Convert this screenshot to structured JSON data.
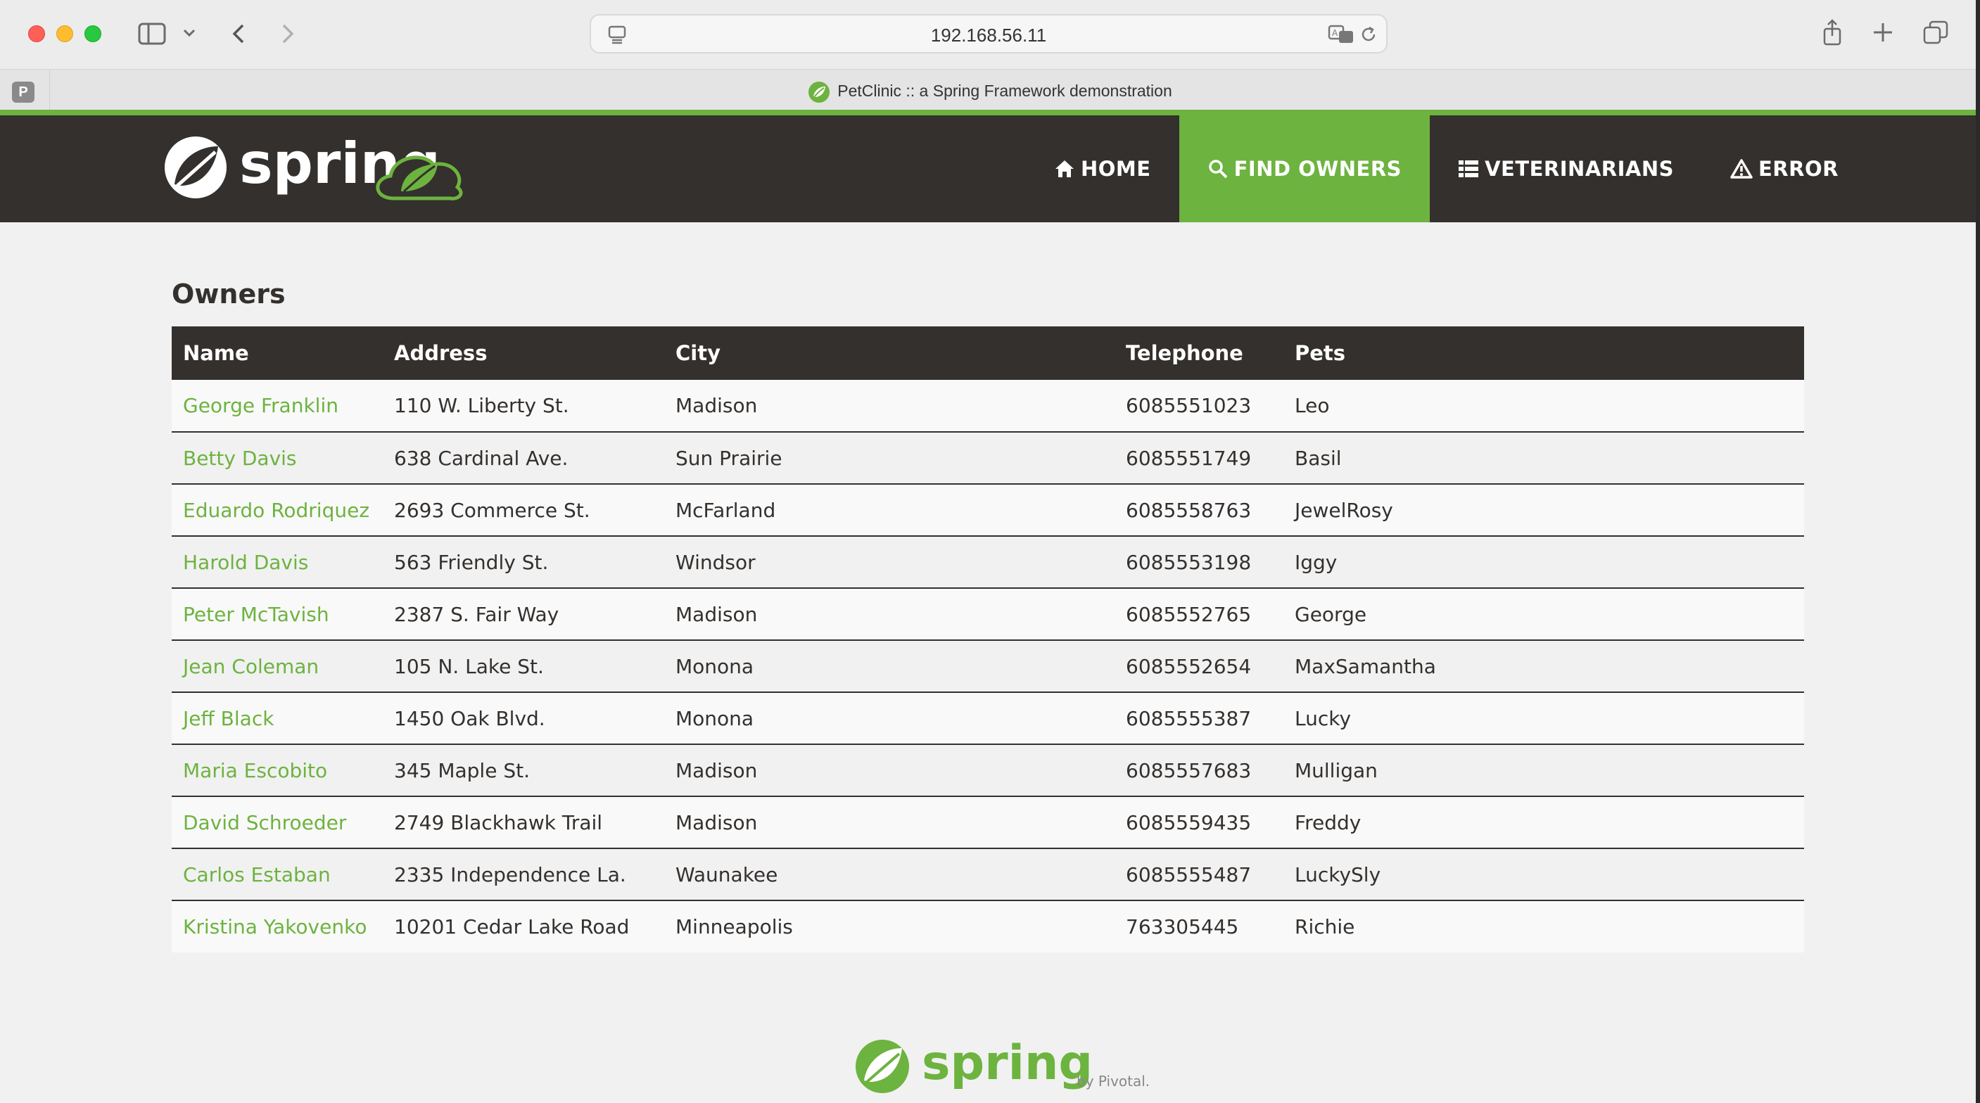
{
  "browser": {
    "address": "192.168.56.11",
    "tab_title": "PetClinic :: a Spring Framework demonstration",
    "tab_pinned_letter": "P"
  },
  "nav": {
    "items": [
      {
        "label": "HOME",
        "icon": "home-icon"
      },
      {
        "label": "FIND OWNERS",
        "icon": "search-icon"
      },
      {
        "label": "VETERINARIANS",
        "icon": "list-icon"
      },
      {
        "label": "ERROR",
        "icon": "warning-icon"
      }
    ],
    "active": "FIND OWNERS"
  },
  "brand": {
    "logo_text": "spring",
    "footer_logo_text": "spring",
    "footer_by": "by Pivotal.",
    "accent_color": "#6db33f",
    "dark_color": "#34302d"
  },
  "page": {
    "title": "Owners",
    "columns": [
      "Name",
      "Address",
      "City",
      "Telephone",
      "Pets"
    ],
    "rows": [
      {
        "name": "George Franklin",
        "address": "110 W. Liberty St.",
        "city": "Madison",
        "telephone": "6085551023",
        "pets": "Leo"
      },
      {
        "name": "Betty Davis",
        "address": "638 Cardinal Ave.",
        "city": "Sun Prairie",
        "telephone": "6085551749",
        "pets": "Basil"
      },
      {
        "name": "Eduardo Rodriquez",
        "address": "2693 Commerce St.",
        "city": "McFarland",
        "telephone": "6085558763",
        "pets": "JewelRosy"
      },
      {
        "name": "Harold Davis",
        "address": "563 Friendly St.",
        "city": "Windsor",
        "telephone": "6085553198",
        "pets": "Iggy"
      },
      {
        "name": "Peter McTavish",
        "address": "2387 S. Fair Way",
        "city": "Madison",
        "telephone": "6085552765",
        "pets": "George"
      },
      {
        "name": "Jean Coleman",
        "address": "105 N. Lake St.",
        "city": "Monona",
        "telephone": "6085552654",
        "pets": "MaxSamantha"
      },
      {
        "name": "Jeff Black",
        "address": "1450 Oak Blvd.",
        "city": "Monona",
        "telephone": "6085555387",
        "pets": "Lucky"
      },
      {
        "name": "Maria Escobito",
        "address": "345 Maple St.",
        "city": "Madison",
        "telephone": "6085557683",
        "pets": "Mulligan"
      },
      {
        "name": "David Schroeder",
        "address": "2749 Blackhawk Trail",
        "city": "Madison",
        "telephone": "6085559435",
        "pets": "Freddy"
      },
      {
        "name": "Carlos Estaban",
        "address": "2335 Independence La.",
        "city": "Waunakee",
        "telephone": "6085555487",
        "pets": "LuckySly"
      },
      {
        "name": "Kristina Yakovenko",
        "address": "10201 Cedar Lake Road",
        "city": "Minneapolis",
        "telephone": "763305445",
        "pets": "Richie"
      }
    ]
  }
}
